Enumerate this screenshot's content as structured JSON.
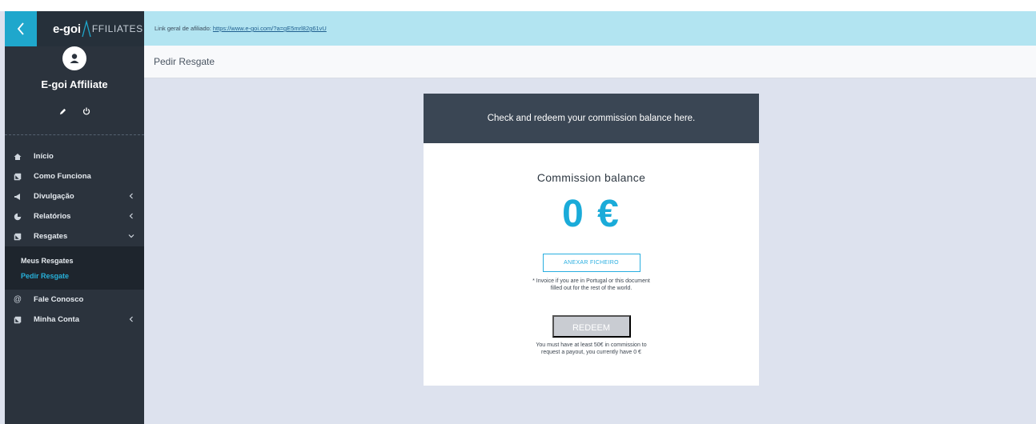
{
  "sidebar": {
    "logo_main": "e-goi",
    "logo_sub": "FFILIATES",
    "profile_name": "E-goi Affiliate",
    "items": [
      {
        "label": "Início",
        "icon": "home-icon"
      },
      {
        "label": "Como Funciona",
        "icon": "book-icon"
      },
      {
        "label": "Divulgação",
        "icon": "megaphone-icon"
      },
      {
        "label": "Relatórios",
        "icon": "chart-icon"
      },
      {
        "label": "Resgates",
        "icon": "book-icon"
      },
      {
        "label": "Fale Conosco",
        "icon": "at-icon"
      },
      {
        "label": "Minha Conta",
        "icon": "book-icon"
      }
    ],
    "submenu": [
      {
        "label": "Meus Resgates"
      },
      {
        "label": "Pedir Resgate"
      }
    ]
  },
  "linkbar": {
    "prefix": "Link geral de afiliado:",
    "url": "https://www.e-goi.com/?a=gE5mrl82g61vU"
  },
  "page_title": "Pedir Resgate",
  "card": {
    "header": "Check and redeem your commission balance here.",
    "balance_label": "Commission balance",
    "balance_value": "0 €",
    "attach_label": "ANEXAR FICHEIRO",
    "attach_note_1": "* Invoice if you are in Portugal or this document",
    "attach_note_2": "filled out for the rest of the world.",
    "redeem_label": "REDEEM",
    "redeem_note_1": "You must have at least 50€ in commission to",
    "redeem_note_2": "request a payout, you currently have 0 €"
  },
  "colors": {
    "accent": "#1aabd9",
    "sidebar_bg": "#2b333d",
    "linkbar_bg": "#b2e4f1",
    "card_header_bg": "#3a4654"
  }
}
